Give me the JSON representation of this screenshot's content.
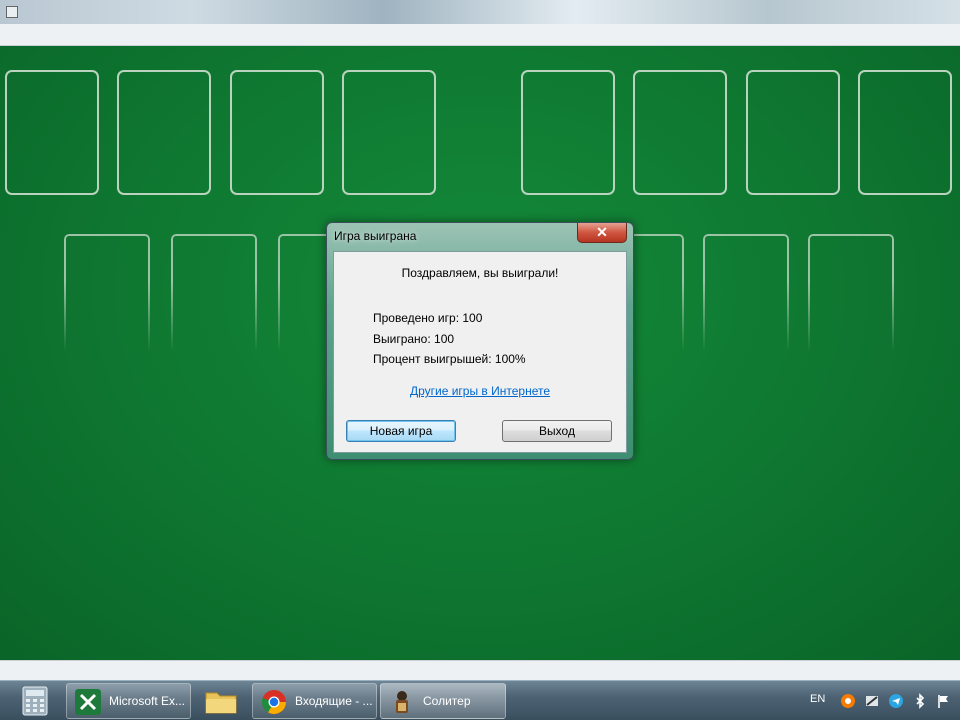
{
  "dialog": {
    "title": "Игра выиграна",
    "close_label": "✕",
    "congrats": "Поздравляем, вы выиграли!",
    "games_played": "Проведено игр: 100",
    "games_won": "Выиграно: 100",
    "win_percent": "Процент выигрышей: 100%",
    "online_games_link": "Другие игры в Интернете",
    "new_game_label": "Новая игра",
    "exit_label": "Выход"
  },
  "taskbar": {
    "items": [
      {
        "label": "",
        "icon": "calculator-icon"
      },
      {
        "label": "Microsoft Ex...",
        "icon": "excel-icon"
      },
      {
        "label": "",
        "icon": "folder-icon"
      },
      {
        "label": "Входящие - ...",
        "icon": "chrome-icon"
      },
      {
        "label": "Солитер",
        "icon": "solitaire-icon"
      }
    ],
    "tray": {
      "language": "EN",
      "icons": [
        "avast-icon",
        "network-tool-icon",
        "telegram-icon",
        "bluetooth-icon",
        "action-center-flag-icon"
      ]
    }
  },
  "colors": {
    "felt": "#0f7a32",
    "dialog_frame": "#5fa48f",
    "close_button": "#cf5641",
    "link": "#0066cc"
  }
}
